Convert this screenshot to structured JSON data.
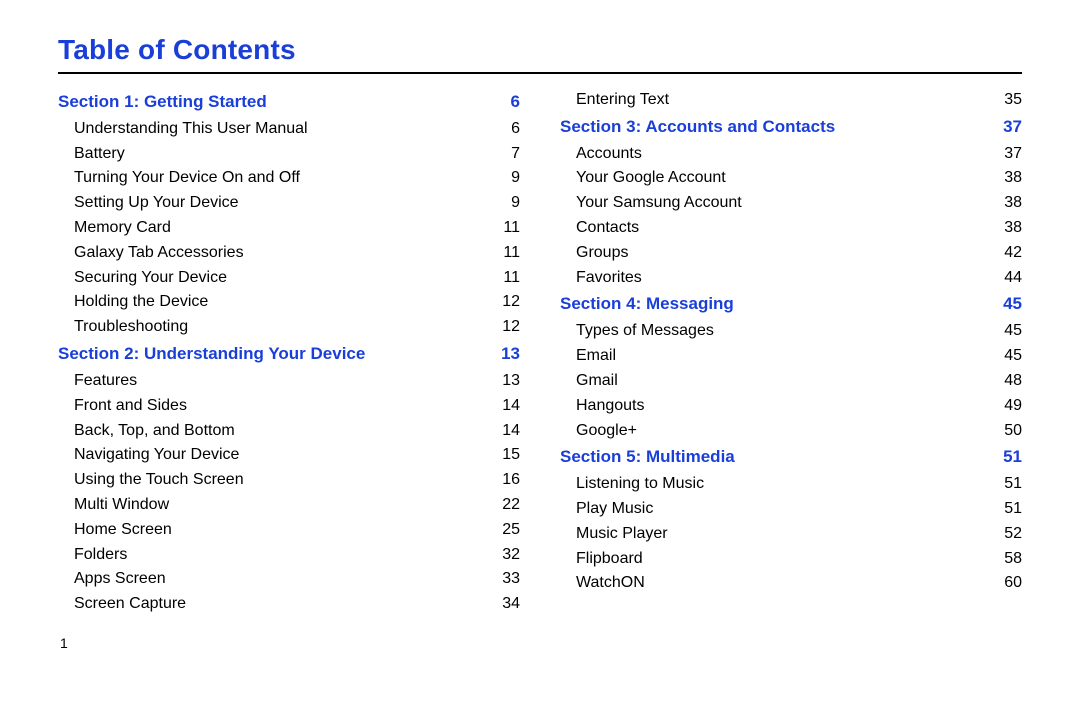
{
  "title": "Table of Contents",
  "page_number": "1",
  "columns": [
    [
      {
        "type": "section",
        "label": "Section 1:  Getting Started",
        "page": "6"
      },
      {
        "type": "item",
        "label": "Understanding This User Manual",
        "page": "6"
      },
      {
        "type": "item",
        "label": "Battery",
        "page": "7"
      },
      {
        "type": "item",
        "label": "Turning Your Device On and Off",
        "page": "9"
      },
      {
        "type": "item",
        "label": "Setting Up Your Device",
        "page": "9"
      },
      {
        "type": "item",
        "label": "Memory Card",
        "page": "11"
      },
      {
        "type": "item",
        "label": "Galaxy Tab Accessories",
        "page": "11"
      },
      {
        "type": "item",
        "label": "Securing Your Device",
        "page": "11"
      },
      {
        "type": "item",
        "label": "Holding the Device",
        "page": "12"
      },
      {
        "type": "item",
        "label": "Troubleshooting",
        "page": "12"
      },
      {
        "type": "section",
        "label": "Section 2:  Understanding Your Device",
        "page": "13"
      },
      {
        "type": "item",
        "label": "Features",
        "page": "13"
      },
      {
        "type": "item",
        "label": "Front and Sides",
        "page": "14"
      },
      {
        "type": "item",
        "label": "Back, Top, and Bottom",
        "page": "14"
      },
      {
        "type": "item",
        "label": "Navigating Your Device",
        "page": "15"
      },
      {
        "type": "item",
        "label": "Using the Touch Screen",
        "page": "16"
      },
      {
        "type": "item",
        "label": "Multi Window",
        "page": "22"
      },
      {
        "type": "item",
        "label": "Home Screen",
        "page": "25"
      },
      {
        "type": "item",
        "label": "Folders",
        "page": "32"
      },
      {
        "type": "item",
        "label": "Apps Screen",
        "page": "33"
      },
      {
        "type": "item",
        "label": "Screen Capture",
        "page": "34"
      }
    ],
    [
      {
        "type": "item",
        "label": "Entering Text",
        "page": "35"
      },
      {
        "type": "section",
        "label": "Section 3:  Accounts and Contacts",
        "page": "37"
      },
      {
        "type": "item",
        "label": "Accounts",
        "page": "37"
      },
      {
        "type": "item",
        "label": "Your Google Account",
        "page": "38"
      },
      {
        "type": "item",
        "label": "Your Samsung Account",
        "page": "38"
      },
      {
        "type": "item",
        "label": "Contacts",
        "page": "38"
      },
      {
        "type": "item",
        "label": "Groups",
        "page": "42"
      },
      {
        "type": "item",
        "label": "Favorites",
        "page": "44"
      },
      {
        "type": "section",
        "label": "Section 4:  Messaging",
        "page": "45"
      },
      {
        "type": "item",
        "label": "Types of Messages",
        "page": "45"
      },
      {
        "type": "item",
        "label": "Email",
        "page": "45"
      },
      {
        "type": "item",
        "label": "Gmail",
        "page": "48"
      },
      {
        "type": "item",
        "label": "Hangouts",
        "page": "49"
      },
      {
        "type": "item",
        "label": "Google+",
        "page": "50"
      },
      {
        "type": "section",
        "label": "Section 5:  Multimedia",
        "page": "51"
      },
      {
        "type": "item",
        "label": "Listening to Music",
        "page": "51"
      },
      {
        "type": "item",
        "label": "Play Music",
        "page": "51"
      },
      {
        "type": "item",
        "label": "Music Player",
        "page": "52"
      },
      {
        "type": "item",
        "label": "Flipboard",
        "page": "58"
      },
      {
        "type": "item",
        "label": "WatchON",
        "page": "60"
      }
    ]
  ]
}
